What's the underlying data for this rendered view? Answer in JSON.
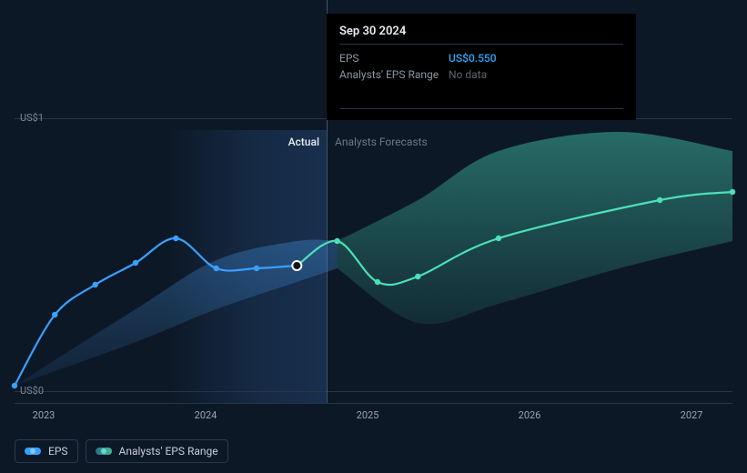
{
  "chart_data": {
    "type": "line",
    "title": "",
    "xlabel": "",
    "ylabel": "",
    "ylim": [
      0,
      1
    ],
    "y_ticks": [
      {
        "value": 0,
        "label": "US$0"
      },
      {
        "value": 1,
        "label": "US$1"
      }
    ],
    "x_ticks": [
      "2023",
      "2024",
      "2025",
      "2026",
      "2027"
    ],
    "regions": {
      "actual": "Actual",
      "forecast": "Analysts Forecasts"
    },
    "series": [
      {
        "name": "EPS",
        "color_actual": "#3aa0ff",
        "color_forecast": "#4de0b8",
        "points": [
          {
            "x": 2022.75,
            "y": 0.02
          },
          {
            "x": 2023.0,
            "y": 0.28
          },
          {
            "x": 2023.25,
            "y": 0.39
          },
          {
            "x": 2023.5,
            "y": 0.47
          },
          {
            "x": 2023.75,
            "y": 0.56
          },
          {
            "x": 2024.0,
            "y": 0.45
          },
          {
            "x": 2024.25,
            "y": 0.45
          },
          {
            "x": 2024.5,
            "y": 0.46
          },
          {
            "x": 2024.75,
            "y": 0.55
          },
          {
            "x": 2025.0,
            "y": 0.4
          },
          {
            "x": 2025.25,
            "y": 0.42
          },
          {
            "x": 2025.75,
            "y": 0.56
          },
          {
            "x": 2026.75,
            "y": 0.7
          },
          {
            "x": 2027.2,
            "y": 0.73
          }
        ]
      },
      {
        "name": "Analysts' EPS Range",
        "band_past_color": "rgba(50,120,200,0.3)",
        "band_future_color": "rgba(60,200,170,0.3)",
        "upper": [
          {
            "x": 2022.75,
            "y": 0.02
          },
          {
            "x": 2023.5,
            "y": 0.3
          },
          {
            "x": 2024.0,
            "y": 0.48
          },
          {
            "x": 2024.5,
            "y": 0.55
          },
          {
            "x": 2024.75,
            "y": 0.55
          },
          {
            "x": 2025.25,
            "y": 0.7
          },
          {
            "x": 2025.75,
            "y": 0.88
          },
          {
            "x": 2026.5,
            "y": 0.95
          },
          {
            "x": 2027.2,
            "y": 0.88
          }
        ],
        "lower": [
          {
            "x": 2022.75,
            "y": 0.02
          },
          {
            "x": 2023.5,
            "y": 0.18
          },
          {
            "x": 2024.0,
            "y": 0.3
          },
          {
            "x": 2024.5,
            "y": 0.4
          },
          {
            "x": 2024.75,
            "y": 0.45
          },
          {
            "x": 2025.25,
            "y": 0.25
          },
          {
            "x": 2025.75,
            "y": 0.32
          },
          {
            "x": 2026.5,
            "y": 0.45
          },
          {
            "x": 2027.2,
            "y": 0.55
          }
        ]
      }
    ],
    "highlight": {
      "date_label": "Sep 30 2024",
      "x": 2024.5,
      "rows": [
        {
          "key": "EPS",
          "value": "US$0.550",
          "class": "eps"
        },
        {
          "key": "Analysts' EPS Range",
          "value": "No data",
          "class": "nodata"
        }
      ]
    }
  },
  "legend": {
    "eps": "EPS",
    "range": "Analysts' EPS Range"
  }
}
